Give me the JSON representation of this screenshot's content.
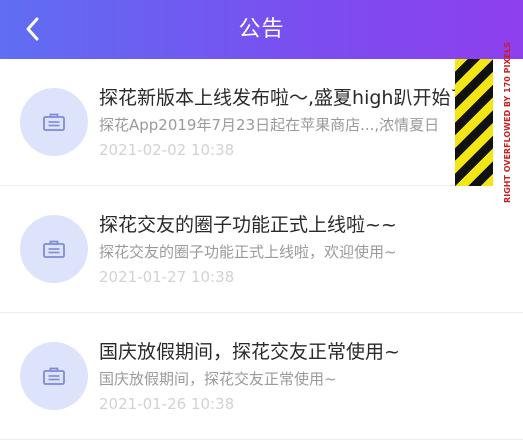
{
  "header": {
    "title": "公告",
    "back_icon": "chevron-left-icon"
  },
  "notices": [
    {
      "title": "探花新版本上线发布啦～,盛夏high趴开始了",
      "desc": "探花App2019年7月23日起在苹果商店...,浓情夏日",
      "time": "2021-02-02 10:38",
      "icon": "briefcase-icon"
    },
    {
      "title": "探花交友的圈子功能正式上线啦~~",
      "desc": "探花交友的圈子功能正式上线啦，欢迎使用~",
      "time": "2021-01-27 10:38",
      "icon": "briefcase-icon"
    },
    {
      "title": "国庆放假期间，探花交友正常使用~",
      "desc": "国庆放假期间，探花交友正常使用~",
      "time": "2021-01-26 10:38",
      "icon": "briefcase-icon"
    }
  ],
  "overflow_banner": {
    "text": "RIGHT OVERFLOWED BY 170 PIXELS"
  },
  "colors": {
    "header_start": "#5f6ef2",
    "header_end": "#8e3fee",
    "avatar_bg": "#dde3fb",
    "icon": "#7d8bd8"
  }
}
